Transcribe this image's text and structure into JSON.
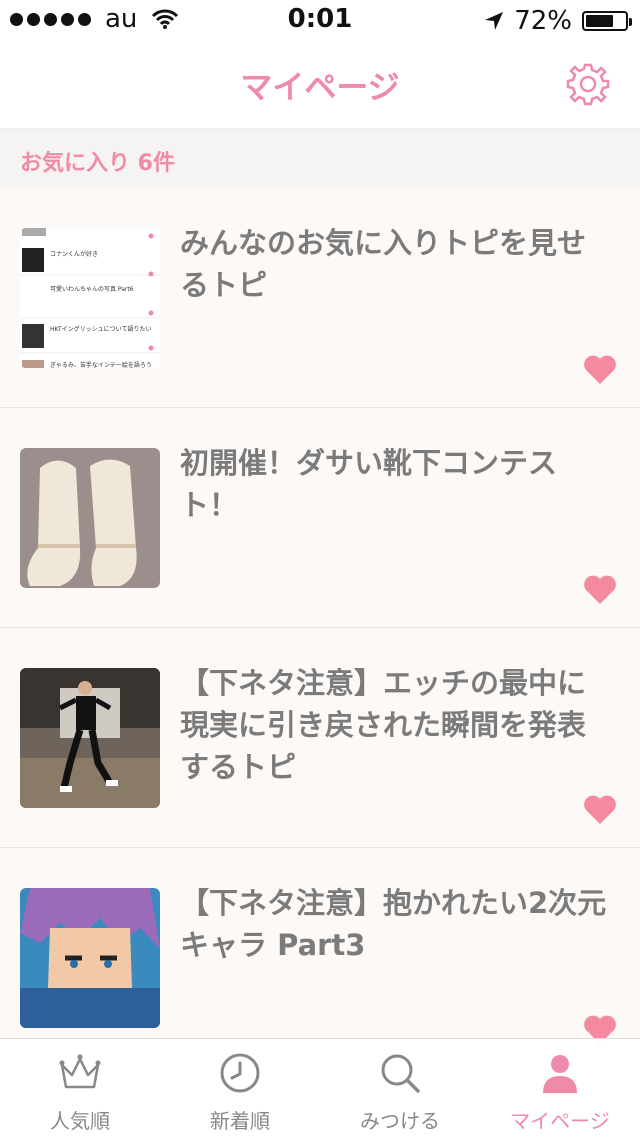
{
  "status": {
    "carrier": "au",
    "time": "0:01",
    "battery": "72%",
    "battery_level": 0.72
  },
  "nav": {
    "title": "マイページ"
  },
  "section": {
    "label": "お気に入り 6件"
  },
  "items": [
    {
      "title": "みんなのお気に入りトピを見せるトピ",
      "thumb_texts": [
        "コナンくんが好き",
        "可愛いわんちゃんの写真 Part6",
        "HKTイングリッシュについて語りたい",
        "ぎゃるみ、苦手なインテー絵を語ろう"
      ]
    },
    {
      "title": "初開催！ダサい靴下コンテスト！"
    },
    {
      "title": "【下ネタ注意】エッチの最中に現実に引き戻された瞬間を発表するトピ"
    },
    {
      "title": "【下ネタ注意】抱かれたい2次元キャラ Part3"
    }
  ],
  "tabs": [
    {
      "label": "人気順",
      "icon": "crown-icon"
    },
    {
      "label": "新着順",
      "icon": "clock-icon"
    },
    {
      "label": "みつける",
      "icon": "search-icon"
    },
    {
      "label": "マイページ",
      "icon": "person-icon"
    }
  ],
  "colors": {
    "accent": "#ef8aa8",
    "text": "#7b7b7b",
    "bg": "#fdf9f6"
  }
}
